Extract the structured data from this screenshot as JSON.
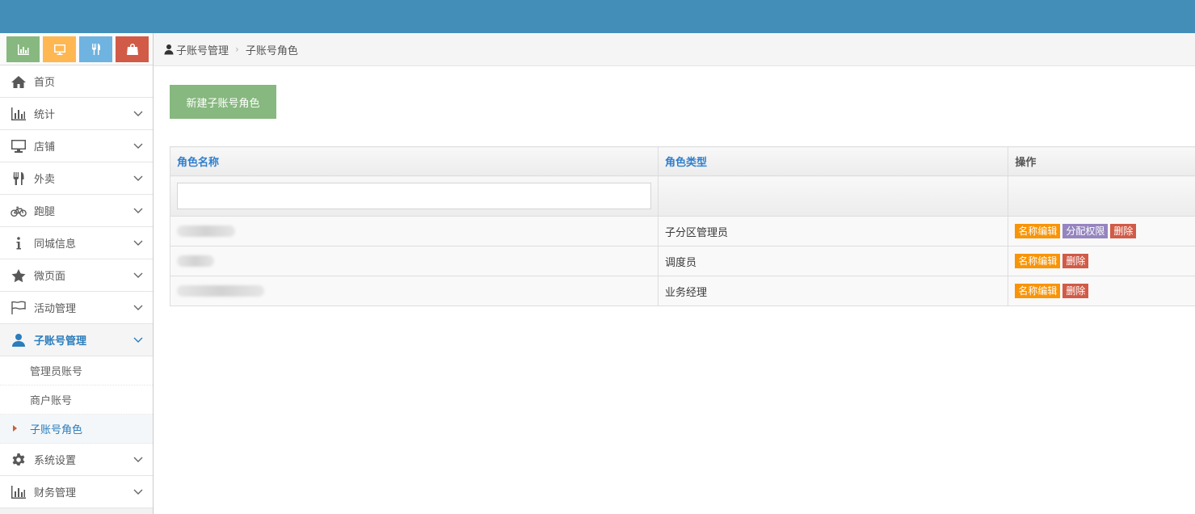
{
  "colors": {
    "topbar": "#438eb9",
    "shortcut_green": "#87b87f",
    "shortcut_yellow": "#ffb752",
    "shortcut_blue": "#6fb3e0",
    "shortcut_red": "#d15b47",
    "accent_blue": "#2b7dbc",
    "btn_edit": "#f89406",
    "btn_perm": "#9585bf",
    "btn_delete": "#d15b47"
  },
  "shortcuts": [
    {
      "icon": "bar-chart-icon",
      "color": "#87b87f"
    },
    {
      "icon": "monitor-icon",
      "color": "#ffb752"
    },
    {
      "icon": "cutlery-icon",
      "color": "#6fb3e0"
    },
    {
      "icon": "shopping-bag-icon",
      "color": "#d15b47"
    }
  ],
  "sidebar": {
    "items": [
      {
        "label": "首页",
        "icon": "home-icon"
      },
      {
        "label": "统计",
        "icon": "bar-chart-icon"
      },
      {
        "label": "店铺",
        "icon": "monitor-icon"
      },
      {
        "label": "外卖",
        "icon": "cutlery-icon"
      },
      {
        "label": "跑腿",
        "icon": "bicycle-icon"
      },
      {
        "label": "同城信息",
        "icon": "info-icon"
      },
      {
        "label": "微页面",
        "icon": "star-icon"
      },
      {
        "label": "活动管理",
        "icon": "flag-icon"
      },
      {
        "label": "子账号管理",
        "icon": "user-icon"
      },
      {
        "label": "系统设置",
        "icon": "gear-icon"
      },
      {
        "label": "财务管理",
        "icon": "bar-chart-icon"
      }
    ],
    "sub_items": [
      {
        "label": "管理员账号"
      },
      {
        "label": "商户账号"
      },
      {
        "label": "子账号角色"
      }
    ]
  },
  "breadcrumb": {
    "items": [
      "子账号管理",
      "子账号角色"
    ]
  },
  "actions": {
    "new_role": "新建子账号角色"
  },
  "table": {
    "headers": [
      "角色名称",
      "角色类型",
      "操作"
    ],
    "buttons": {
      "edit": "名称编辑",
      "perm": "分配权限",
      "delete": "删除"
    },
    "rows": [
      {
        "type": "子分区管理员"
      },
      {
        "type": "调度员"
      },
      {
        "type": "业务经理"
      }
    ]
  }
}
